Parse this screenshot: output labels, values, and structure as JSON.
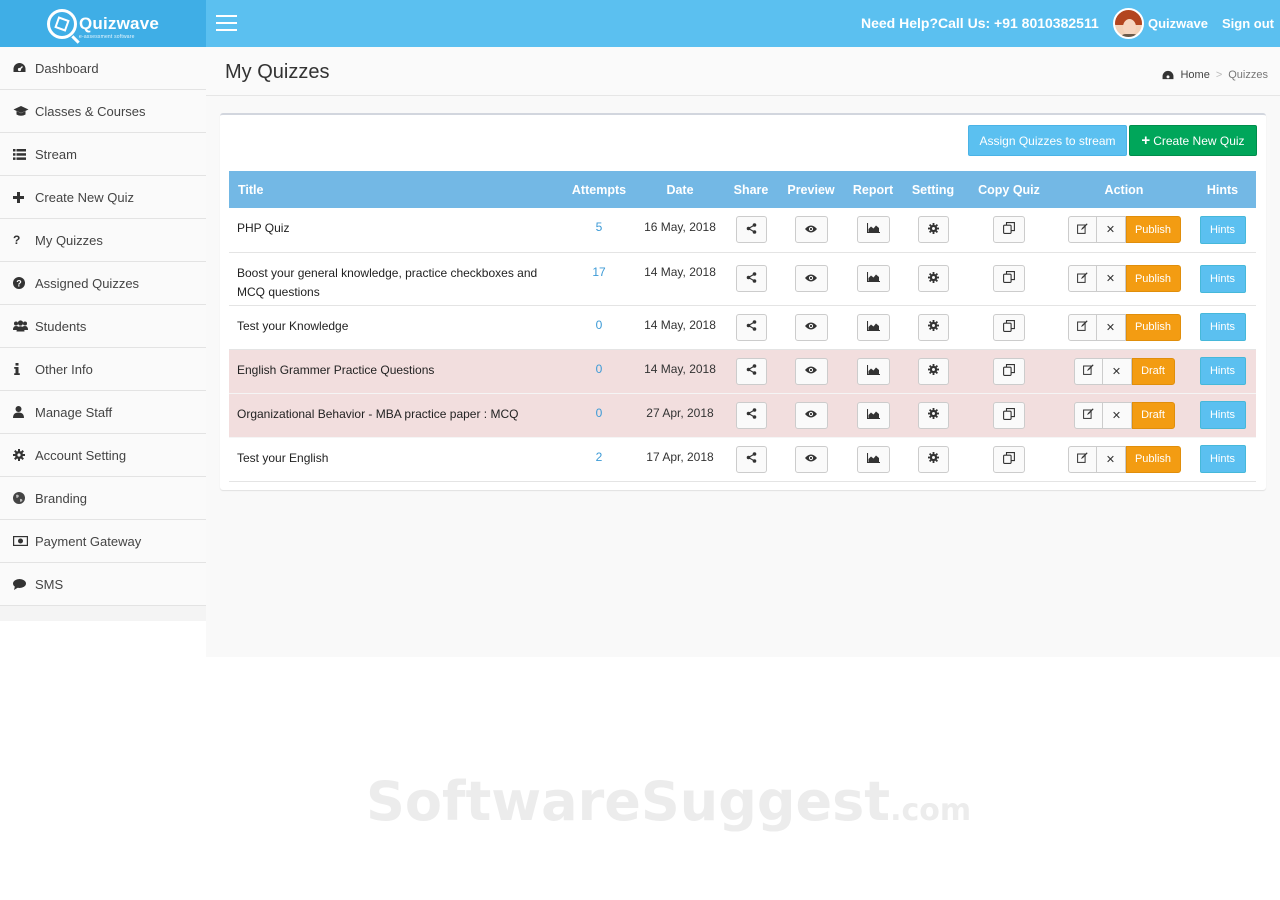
{
  "app": {
    "logo_text": "Quizwave",
    "logo_subtitle": "e-assessment software",
    "help_text": "Need Help?Call Us: +91 8010382511",
    "user_name": "Quizwave",
    "signout_label": "Sign out"
  },
  "sidebar": {
    "items": [
      {
        "label": "Dashboard",
        "icon": "dashboard-icon"
      },
      {
        "label": "Classes & Courses",
        "icon": "graduation-cap-icon"
      },
      {
        "label": "Stream",
        "icon": "list-icon"
      },
      {
        "label": "Create New Quiz",
        "icon": "plus-icon"
      },
      {
        "label": "My Quizzes",
        "icon": "question-icon"
      },
      {
        "label": "Assigned Quizzes",
        "icon": "question-circle-icon"
      },
      {
        "label": "Students",
        "icon": "users-icon"
      },
      {
        "label": "Other Info",
        "icon": "info-icon"
      },
      {
        "label": "Manage Staff",
        "icon": "user-icon"
      },
      {
        "label": "Account Setting",
        "icon": "gear-icon"
      },
      {
        "label": "Branding",
        "icon": "globe-icon"
      },
      {
        "label": "Payment Gateway",
        "icon": "money-icon"
      },
      {
        "label": "SMS",
        "icon": "comment-icon"
      }
    ]
  },
  "page": {
    "title": "My Quizzes",
    "breadcrumb": {
      "home": "Home",
      "separator": ">",
      "current": "Quizzes"
    }
  },
  "toolbar": {
    "assign_label": "Assign Quizzes to stream",
    "create_label": "Create New Quiz"
  },
  "table": {
    "headers": {
      "title": "Title",
      "attempts": "Attempts",
      "date": "Date",
      "share": "Share",
      "preview": "Preview",
      "report": "Report",
      "setting": "Setting",
      "copy": "Copy Quiz",
      "action": "Action",
      "hints": "Hints"
    },
    "hints_label": "Hints",
    "rows": [
      {
        "title": "PHP Quiz",
        "attempts": "5",
        "date": "16 May, 2018",
        "status": "Publish"
      },
      {
        "title": "Boost your general knowledge, practice checkboxes and MCQ questions",
        "attempts": "17",
        "date": "14 May, 2018",
        "status": "Publish"
      },
      {
        "title": "Test your Knowledge",
        "attempts": "0",
        "date": "14 May, 2018",
        "status": "Publish"
      },
      {
        "title": "English Grammer Practice Questions",
        "attempts": "0",
        "date": "14 May, 2018",
        "status": "Draft"
      },
      {
        "title": "Organizational Behavior - MBA practice paper : MCQ",
        "attempts": "0",
        "date": "27 Apr, 2018",
        "status": "Draft"
      },
      {
        "title": "Test your English",
        "attempts": "2",
        "date": "17 Apr, 2018",
        "status": "Publish"
      }
    ]
  },
  "watermark": {
    "main": "SoftwareSuggest",
    "suffix": ".com"
  },
  "colors": {
    "topbar": "#5bc0f0",
    "logo_bg": "#3faee6",
    "table_header": "#73b8e5",
    "publish": "#f39c12",
    "create_button": "#00a65a",
    "draft_row": "#f2dede"
  }
}
